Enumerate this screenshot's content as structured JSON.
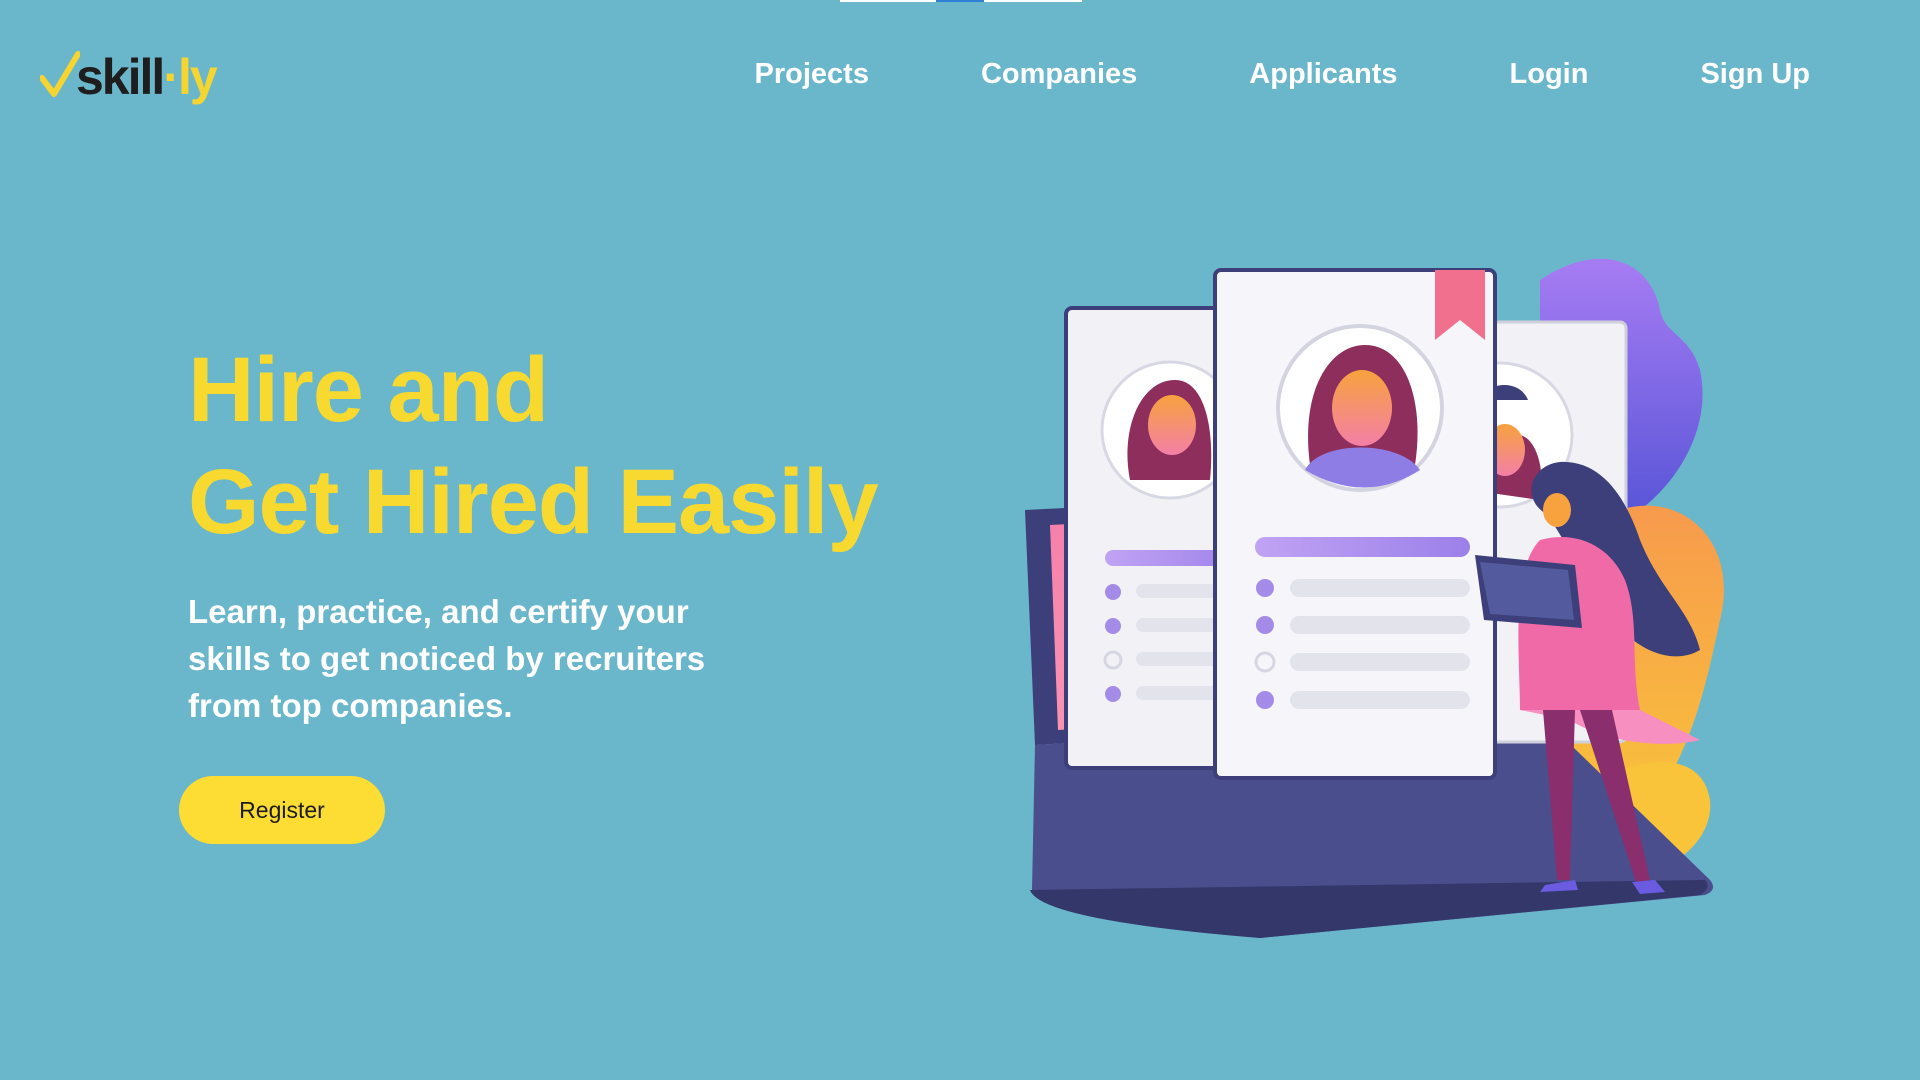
{
  "logo": {
    "prefix": "skill",
    "dot": "·",
    "suffix": "ly"
  },
  "nav": {
    "projects": "Projects",
    "companies": "Companies",
    "applicants": "Applicants",
    "login": "Login",
    "signup": "Sign Up"
  },
  "hero": {
    "title_line1": "Hire and",
    "title_line2": "Get Hired Easily",
    "subtitle": "Learn, practice, and certify your skills to get noticed by recruiters from top companies.",
    "cta": "Register"
  },
  "colors": {
    "background": "#6ab7cb",
    "accent_yellow": "#f8d92f",
    "text_white": "#ffffff"
  },
  "icons": {
    "logo_mark": "checkmark-icon",
    "illustration": "resume-cards-illustration"
  }
}
